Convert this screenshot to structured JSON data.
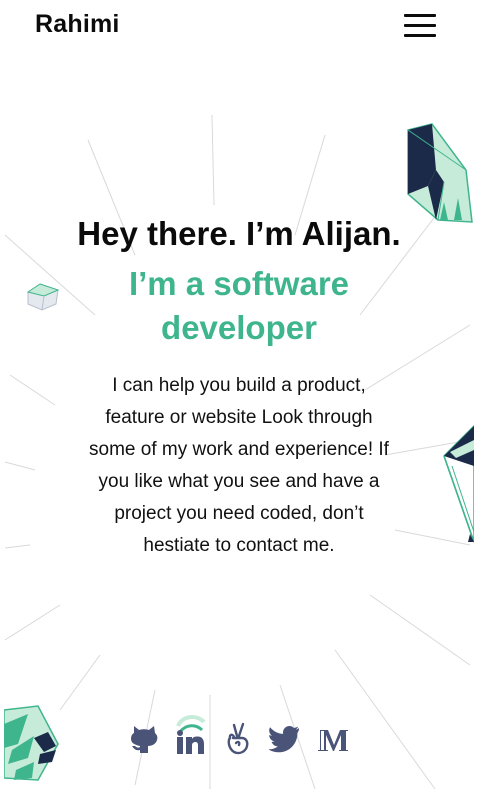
{
  "header": {
    "brand": "Rahimi",
    "menu_icon": "hamburger-menu-icon"
  },
  "hero": {
    "title": "Hey there. I’m Alijan.",
    "subtitle": "I’m a software developer",
    "description": "I can help you build a product, feature or website Look through some of my work and experience! If you like what you see and have a project you need coded, don’t hestiate to contact me."
  },
  "social": [
    {
      "icon": "github-icon"
    },
    {
      "icon": "linkedin-icon"
    },
    {
      "icon": "angellist-icon"
    },
    {
      "icon": "twitter-icon"
    },
    {
      "icon": "medium-icon"
    }
  ],
  "colors": {
    "accent": "#3fb58d",
    "text": "#0b0b0b",
    "icon": "#4a5478",
    "navy": "#1c2a4a"
  }
}
